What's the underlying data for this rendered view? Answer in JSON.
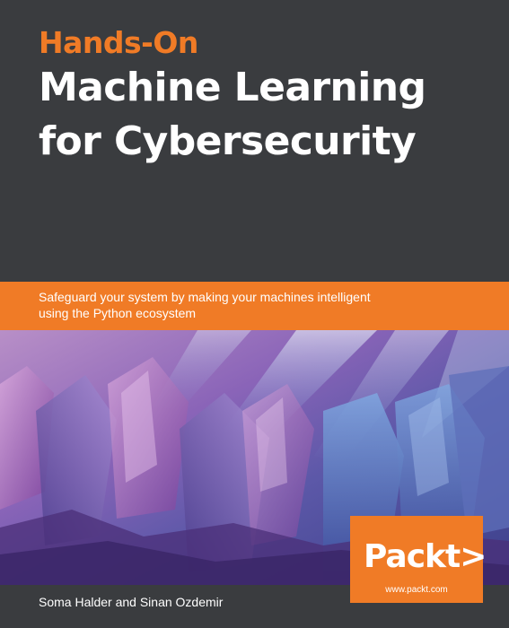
{
  "book": {
    "pre_title": "Hands-On",
    "title_line_1": "Machine Learning",
    "title_line_2": "for Cybersecurity",
    "subtitle_line_1": "Safeguard your system by making your machines intelligent",
    "subtitle_line_2": "using the Python ecosystem",
    "authors": "Soma Halder and Sinan Ozdemir"
  },
  "publisher": {
    "logo": "Packt>",
    "url": "www.packt.com"
  },
  "colors": {
    "accent": "#f07b26",
    "background": "#3a3c3f",
    "text": "#ffffff"
  }
}
